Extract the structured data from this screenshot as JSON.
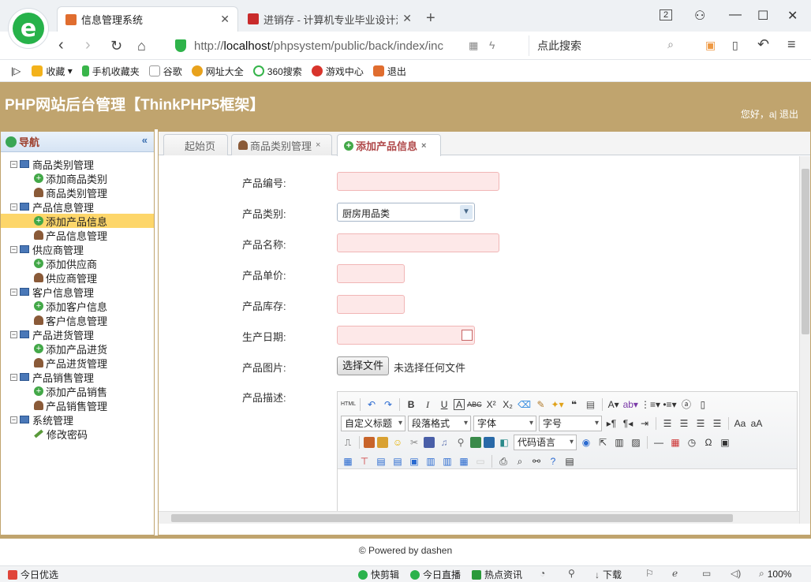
{
  "browser": {
    "tabs": [
      {
        "title": "信息管理系统",
        "active": true
      },
      {
        "title": "进销存 - 计算机专业毕业设计源码",
        "active": false
      }
    ],
    "tab_count": "2",
    "url_scheme": "http://",
    "url_host": "localhost",
    "url_path": "/phpsystem/public/back/index/inc",
    "search_placeholder": "点此搜索",
    "bookmarks": [
      "收藏",
      "手机收藏夹",
      "谷歌",
      "网址大全",
      "360搜索",
      "游戏中心",
      "退出"
    ]
  },
  "admin": {
    "title": "PHP网站后台管理【ThinkPHP5框架】",
    "greeting": "您好，a|",
    "logout": "退出"
  },
  "sidebar": {
    "title": "导航",
    "groups": [
      {
        "label": "商品类别管理",
        "items": [
          "添加商品类别",
          "商品类别管理"
        ]
      },
      {
        "label": "产品信息管理",
        "items": [
          "添加产品信息",
          "产品信息管理"
        ]
      },
      {
        "label": "供应商管理",
        "items": [
          "添加供应商",
          "供应商管理"
        ]
      },
      {
        "label": "客户信息管理",
        "items": [
          "添加客户信息",
          "客户信息管理"
        ]
      },
      {
        "label": "产品进货管理",
        "items": [
          "添加产品进货",
          "产品进货管理"
        ]
      },
      {
        "label": "产品销售管理",
        "items": [
          "添加产品销售",
          "产品销售管理"
        ]
      },
      {
        "label": "系统管理",
        "items": [
          "修改密码"
        ]
      }
    ]
  },
  "page_tabs": [
    "起始页",
    "商品类别管理",
    "添加产品信息"
  ],
  "form": {
    "code_label": "产品编号:",
    "category_label": "产品类别:",
    "category_value": "厨房用品类",
    "name_label": "产品名称:",
    "price_label": "产品单价:",
    "stock_label": "产品库存:",
    "date_label": "生产日期:",
    "image_label": "产品图片:",
    "file_button": "选择文件",
    "file_status": "未选择任何文件",
    "desc_label": "产品描述:"
  },
  "editor": {
    "html_label": "HTML",
    "custom_title": "自定义标题",
    "paragraph": "段落格式",
    "font": "字体",
    "size": "字号",
    "code_lang": "代码语言"
  },
  "footer": "© Powered by dashen",
  "status": {
    "left": "今日优选",
    "items": [
      "快剪辑",
      "今日直播",
      "热点资讯",
      "下载"
    ],
    "zoom": "100%"
  }
}
